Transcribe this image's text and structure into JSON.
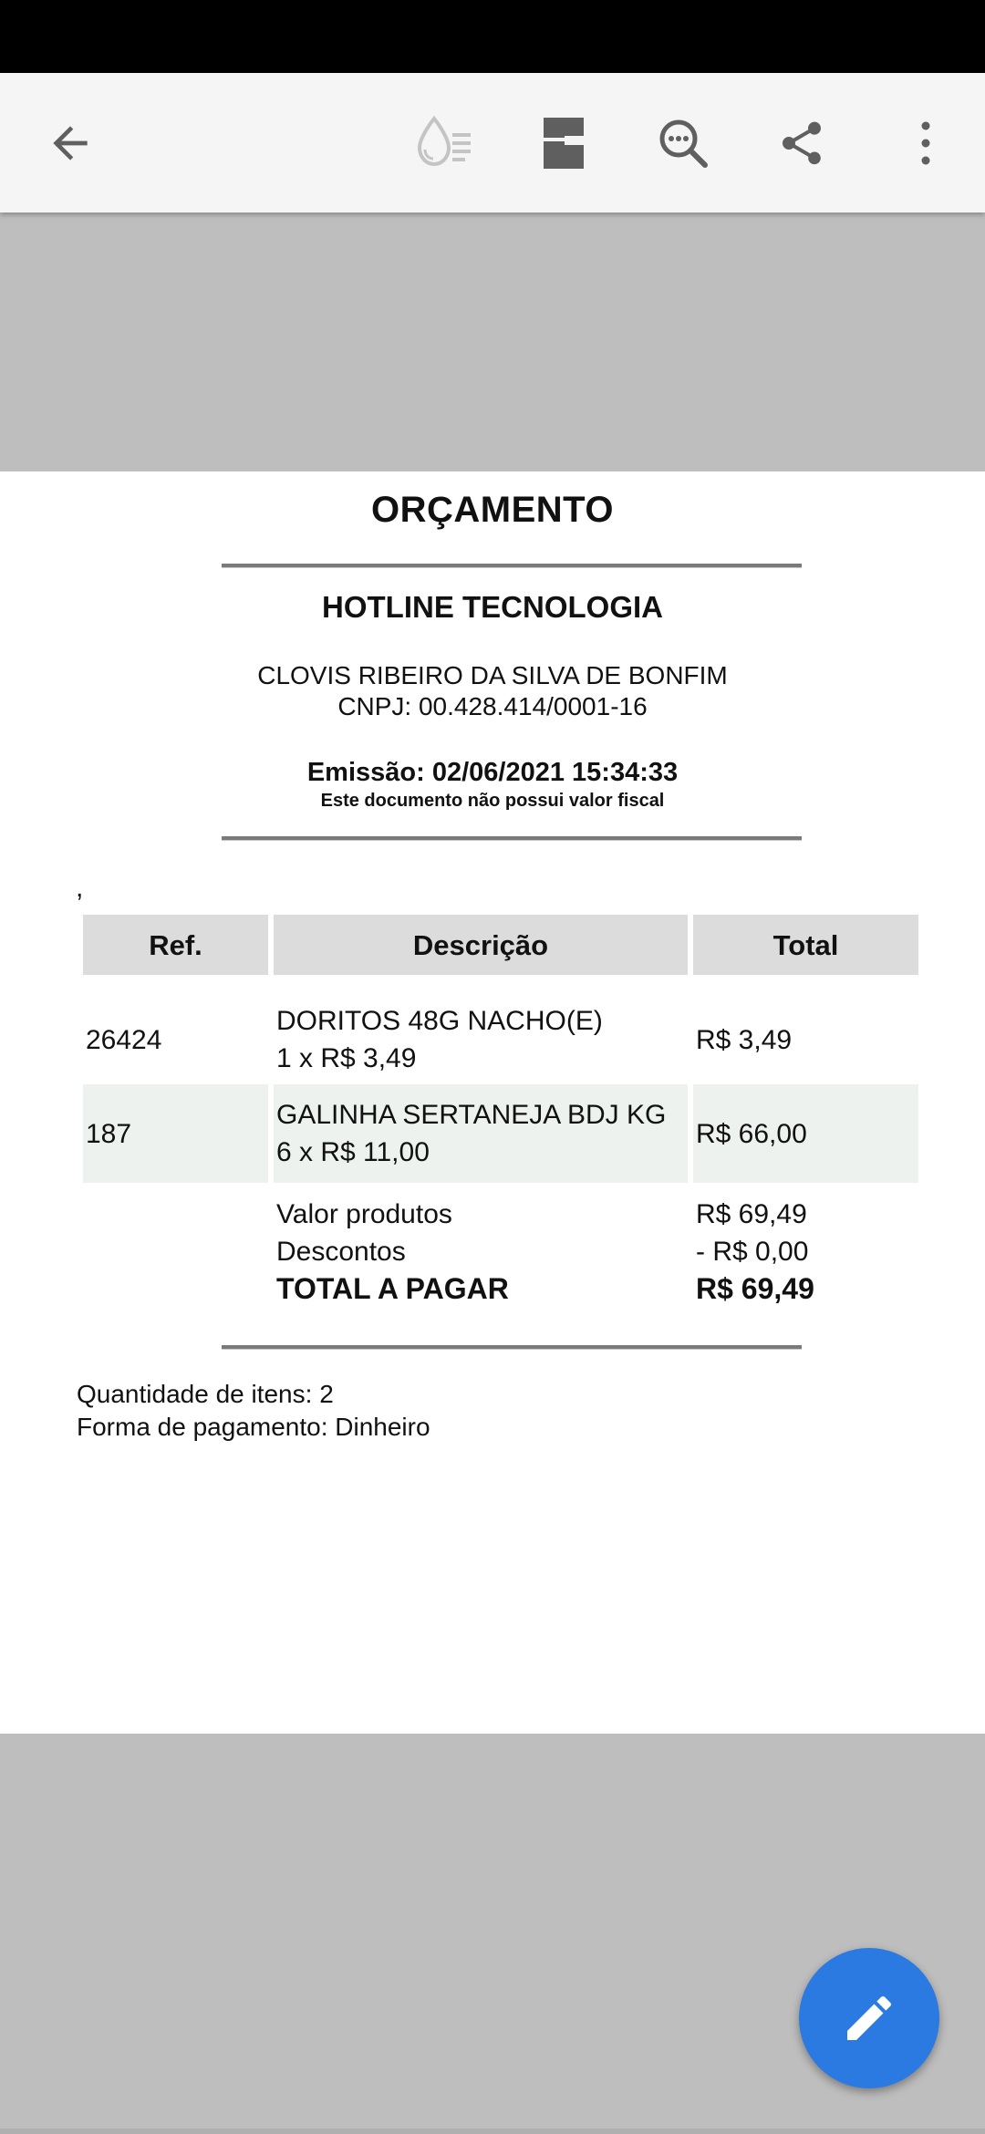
{
  "toolbar": {
    "icons": [
      "back-arrow-icon",
      "ink-drop-icon",
      "page-layout-icon",
      "search-in-document-icon",
      "share-icon",
      "more-options-icon"
    ]
  },
  "document": {
    "title": "ORÇAMENTO",
    "company": "HOTLINE TECNOLOGIA",
    "owner": "CLOVIS RIBEIRO DA SILVA DE BONFIM",
    "cnpj": "CNPJ: 00.428.414/0001-16",
    "emission": "Emissão: 02/06/2021 15:34:33",
    "disclaimer": "Este documento não possui valor fiscal",
    "stray_mark": ",",
    "table": {
      "headers": [
        "Ref.",
        "Descrição",
        "Total"
      ],
      "rows": [
        {
          "ref": "26424",
          "desc": "DORITOS 48G NACHO(E)",
          "qty": "1 x R$ 3,49",
          "total": "R$ 3,49"
        },
        {
          "ref": "187",
          "desc": "GALINHA SERTANEJA BDJ KG",
          "qty": "6 x R$ 11,00",
          "total": "R$ 66,00"
        }
      ]
    },
    "summary": {
      "products_label": "Valor produtos",
      "products_value": "R$ 69,49",
      "discount_label": "Descontos",
      "discount_value": "- R$ 0,00",
      "total_label": "TOTAL A PAGAR",
      "total_value": "R$ 69,49"
    },
    "item_count": "Quantidade de itens: 2",
    "payment": "Forma de pagamento: Dinheiro"
  },
  "fab": {
    "icon": "edit-pencil-icon"
  },
  "colors": {
    "fab": "#2a7ae2",
    "toolbar": "#f5f5f5",
    "viewer_background": "#bebebe",
    "row_shade": "#eef2ef",
    "header_cell": "#dcdcdc"
  }
}
